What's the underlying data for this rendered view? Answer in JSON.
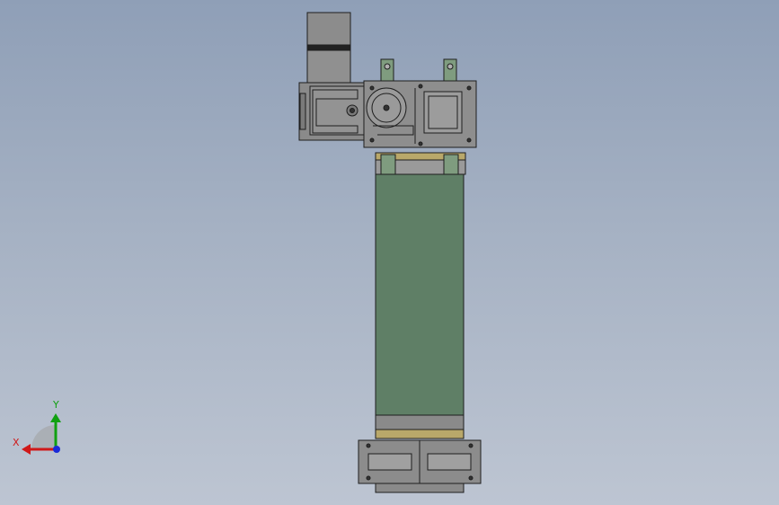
{
  "viewport": {
    "background_top": "#8f9fb7",
    "background_bottom": "#bdc5d2"
  },
  "model": {
    "colors": {
      "body_gray": "#8c8c8c",
      "dark_gray": "#6e6e6e",
      "tube_green": "#5f7f66",
      "bracket_green": "#7f9c7f",
      "ring_gold": "#b9a86a",
      "edge": "#1e1e1e"
    }
  },
  "triad": {
    "x_label": "X",
    "y_label": "Y",
    "x_color": "#d01818",
    "y_color": "#10a010",
    "z_color": "#1a2ad8"
  }
}
